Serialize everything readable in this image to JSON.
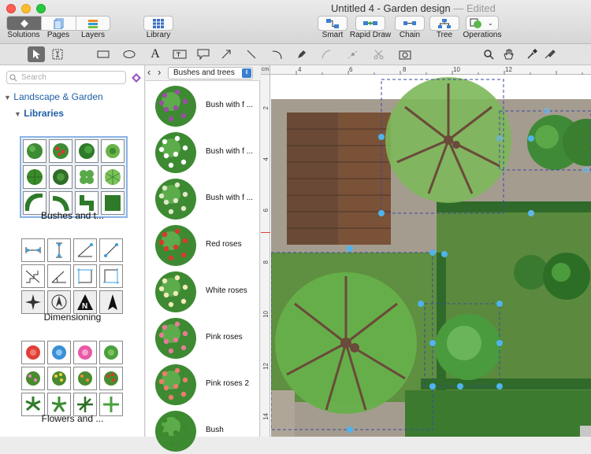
{
  "window": {
    "title": "Untitled 4 - Garden design",
    "edited": "— Edited"
  },
  "top_buttons": {
    "solutions": "Solutions",
    "pages": "Pages",
    "layers": "Layers",
    "library": "Library",
    "smart": "Smart",
    "rapid_draw": "Rapid Draw",
    "chain": "Chain",
    "tree": "Tree",
    "operations": "Operations"
  },
  "sidebar": {
    "search_placeholder": "Search",
    "section": "Landscape & Garden",
    "libraries": "Libraries",
    "libs": [
      {
        "label": "Bushes and t..."
      },
      {
        "label": "Dimensioning"
      },
      {
        "label": "Flowers and ..."
      }
    ]
  },
  "list_panel": {
    "selected": "Bushes and trees",
    "items": [
      {
        "label": "Bush with f ...",
        "color": "#9b4ea3"
      },
      {
        "label": "Bush with f ...",
        "color": "#ffffff"
      },
      {
        "label": "Bush with f ...",
        "color": "#dfe9c8"
      },
      {
        "label": "Red roses",
        "color": "#d83a2c"
      },
      {
        "label": "White roses",
        "color": "#f2e9b8"
      },
      {
        "label": "Pink roses",
        "color": "#e77c95"
      },
      {
        "label": "Pink roses 2",
        "color": "#ee7c6e"
      },
      {
        "label": "Bush",
        "color": "#3a8a2a"
      }
    ]
  },
  "ruler": {
    "h": [
      "4",
      "6",
      "8",
      "10",
      "12"
    ],
    "v": [
      "2",
      "4",
      "6",
      "8",
      "10",
      "12",
      "14"
    ],
    "unit": "cm"
  }
}
